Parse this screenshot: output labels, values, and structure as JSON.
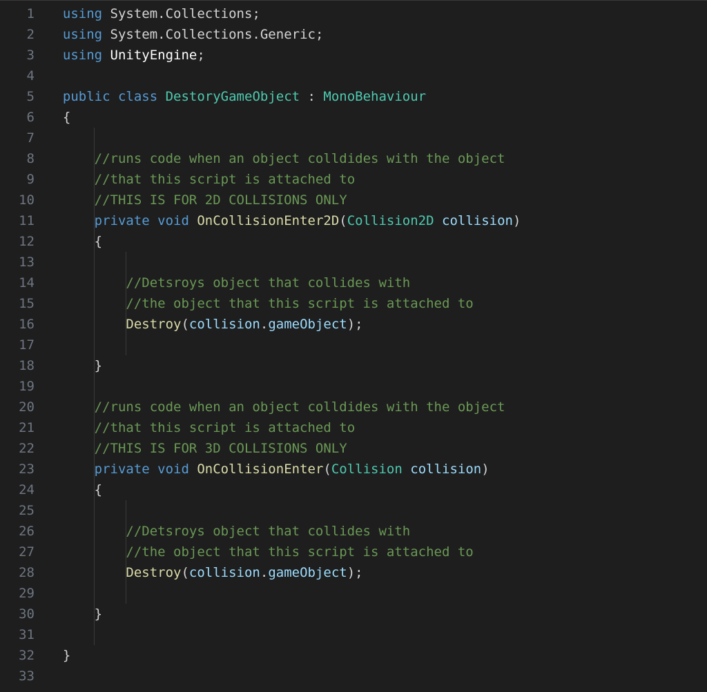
{
  "lines": [
    {
      "n": 1,
      "indent": 0,
      "guides": [],
      "tokens": [
        {
          "t": "using ",
          "c": "kw"
        },
        {
          "t": "System.Collections",
          "c": "ns"
        },
        {
          "t": ";",
          "c": "pun"
        }
      ]
    },
    {
      "n": 2,
      "indent": 0,
      "guides": [],
      "tokens": [
        {
          "t": "using ",
          "c": "kw"
        },
        {
          "t": "System.Collections.Generic",
          "c": "ns"
        },
        {
          "t": ";",
          "c": "pun"
        }
      ]
    },
    {
      "n": 3,
      "indent": 0,
      "guides": [],
      "tokens": [
        {
          "t": "using ",
          "c": "kw"
        },
        {
          "t": "UnityEngine",
          "c": "white"
        },
        {
          "t": ";",
          "c": "pun"
        }
      ]
    },
    {
      "n": 4,
      "indent": 0,
      "guides": [],
      "tokens": []
    },
    {
      "n": 5,
      "indent": 0,
      "guides": [],
      "tokens": [
        {
          "t": "public ",
          "c": "kw"
        },
        {
          "t": "class ",
          "c": "kw"
        },
        {
          "t": "DestoryGameObject",
          "c": "cls"
        },
        {
          "t": " : ",
          "c": "pun"
        },
        {
          "t": "MonoBehaviour",
          "c": "cls"
        }
      ]
    },
    {
      "n": 6,
      "indent": 0,
      "guides": [],
      "tokens": [
        {
          "t": "{",
          "c": "pun"
        }
      ]
    },
    {
      "n": 7,
      "indent": 1,
      "guides": [
        0
      ],
      "tokens": []
    },
    {
      "n": 8,
      "indent": 1,
      "guides": [
        0
      ],
      "tokens": [
        {
          "t": "//runs code when an object colldides with the object",
          "c": "cmt"
        }
      ]
    },
    {
      "n": 9,
      "indent": 1,
      "guides": [
        0
      ],
      "tokens": [
        {
          "t": "//that this script is attached to",
          "c": "cmt"
        }
      ]
    },
    {
      "n": 10,
      "indent": 1,
      "guides": [
        0
      ],
      "tokens": [
        {
          "t": "//THIS IS FOR 2D COLLISIONS ONLY",
          "c": "cmt"
        }
      ]
    },
    {
      "n": 11,
      "indent": 1,
      "guides": [
        0
      ],
      "tokens": [
        {
          "t": "private ",
          "c": "kw"
        },
        {
          "t": "void ",
          "c": "kw"
        },
        {
          "t": "OnCollisionEnter2D",
          "c": "fn"
        },
        {
          "t": "(",
          "c": "pun"
        },
        {
          "t": "Collision2D",
          "c": "cls"
        },
        {
          "t": " ",
          "c": "pun"
        },
        {
          "t": "collision",
          "c": "var"
        },
        {
          "t": ")",
          "c": "pun"
        }
      ]
    },
    {
      "n": 12,
      "indent": 1,
      "guides": [
        0
      ],
      "tokens": [
        {
          "t": "{",
          "c": "pun"
        }
      ]
    },
    {
      "n": 13,
      "indent": 2,
      "guides": [
        0,
        1
      ],
      "tokens": []
    },
    {
      "n": 14,
      "indent": 2,
      "guides": [
        0,
        1
      ],
      "tokens": [
        {
          "t": "//Detsroys object that collides with",
          "c": "cmt"
        }
      ]
    },
    {
      "n": 15,
      "indent": 2,
      "guides": [
        0,
        1
      ],
      "tokens": [
        {
          "t": "//the object that this script is attached to",
          "c": "cmt"
        }
      ]
    },
    {
      "n": 16,
      "indent": 2,
      "guides": [
        0,
        1
      ],
      "tokens": [
        {
          "t": "Destroy",
          "c": "fn"
        },
        {
          "t": "(",
          "c": "pun"
        },
        {
          "t": "collision",
          "c": "var"
        },
        {
          "t": ".",
          "c": "pun"
        },
        {
          "t": "gameObject",
          "c": "var"
        },
        {
          "t": ");",
          "c": "pun"
        }
      ]
    },
    {
      "n": 17,
      "indent": 2,
      "guides": [
        0,
        1
      ],
      "tokens": []
    },
    {
      "n": 18,
      "indent": 1,
      "guides": [
        0
      ],
      "tokens": [
        {
          "t": "}",
          "c": "pun"
        }
      ]
    },
    {
      "n": 19,
      "indent": 1,
      "guides": [
        0
      ],
      "tokens": []
    },
    {
      "n": 20,
      "indent": 1,
      "guides": [
        0
      ],
      "tokens": [
        {
          "t": "//runs code when an object colldides with the object",
          "c": "cmt"
        }
      ]
    },
    {
      "n": 21,
      "indent": 1,
      "guides": [
        0
      ],
      "tokens": [
        {
          "t": "//that this script is attached to",
          "c": "cmt"
        }
      ]
    },
    {
      "n": 22,
      "indent": 1,
      "guides": [
        0
      ],
      "tokens": [
        {
          "t": "//THIS IS FOR 3D COLLISIONS ONLY",
          "c": "cmt"
        }
      ]
    },
    {
      "n": 23,
      "indent": 1,
      "guides": [
        0
      ],
      "tokens": [
        {
          "t": "private ",
          "c": "kw"
        },
        {
          "t": "void ",
          "c": "kw"
        },
        {
          "t": "OnCollisionEnter",
          "c": "fn"
        },
        {
          "t": "(",
          "c": "pun"
        },
        {
          "t": "Collision",
          "c": "cls"
        },
        {
          "t": " ",
          "c": "pun"
        },
        {
          "t": "collision",
          "c": "var"
        },
        {
          "t": ")",
          "c": "pun"
        }
      ]
    },
    {
      "n": 24,
      "indent": 1,
      "guides": [
        0
      ],
      "tokens": [
        {
          "t": "{",
          "c": "pun"
        }
      ]
    },
    {
      "n": 25,
      "indent": 2,
      "guides": [
        0,
        1
      ],
      "tokens": []
    },
    {
      "n": 26,
      "indent": 2,
      "guides": [
        0,
        1
      ],
      "tokens": [
        {
          "t": "//Detsroys object that collides with",
          "c": "cmt"
        }
      ]
    },
    {
      "n": 27,
      "indent": 2,
      "guides": [
        0,
        1
      ],
      "glyph": true,
      "tokens": [
        {
          "t": "//the object that this script is attached to",
          "c": "cmt"
        }
      ]
    },
    {
      "n": 28,
      "indent": 2,
      "guides": [
        0,
        1
      ],
      "tokens": [
        {
          "t": "Destroy",
          "c": "fn"
        },
        {
          "t": "(",
          "c": "pun"
        },
        {
          "t": "collision",
          "c": "var"
        },
        {
          "t": ".",
          "c": "pun"
        },
        {
          "t": "gameObject",
          "c": "var"
        },
        {
          "t": ");",
          "c": "pun"
        }
      ]
    },
    {
      "n": 29,
      "indent": 2,
      "guides": [
        0,
        1
      ],
      "tokens": []
    },
    {
      "n": 30,
      "indent": 1,
      "guides": [
        0
      ],
      "tokens": [
        {
          "t": "}",
          "c": "pun"
        }
      ]
    },
    {
      "n": 31,
      "indent": 1,
      "guides": [
        0
      ],
      "tokens": []
    },
    {
      "n": 32,
      "indent": 0,
      "guides": [],
      "tokens": [
        {
          "t": "}",
          "c": "pun"
        }
      ]
    },
    {
      "n": 33,
      "indent": 0,
      "guides": [],
      "tokens": []
    }
  ],
  "indentWidth": 4,
  "baseIndentPx": 0,
  "glyphChar": "✎"
}
